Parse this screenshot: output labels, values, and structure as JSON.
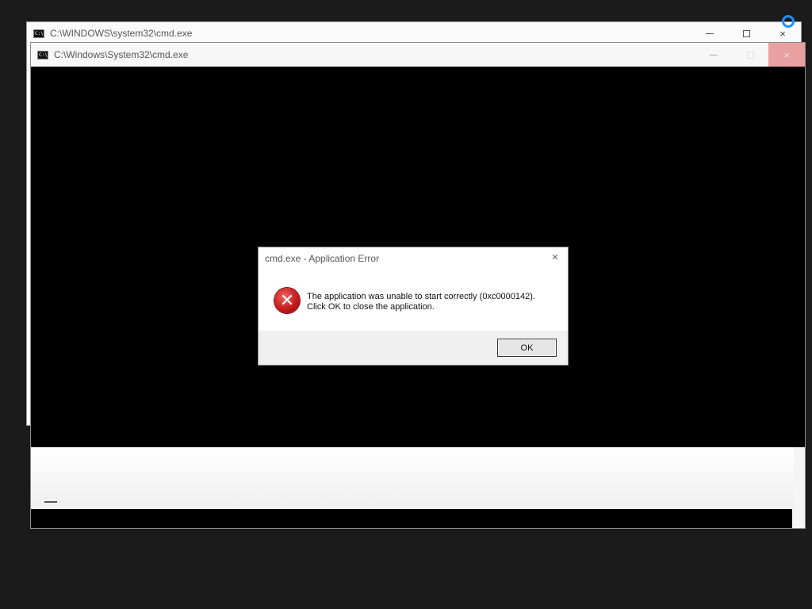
{
  "back_window": {
    "title": "C:\\WINDOWS\\system32\\cmd.exe",
    "icon": "cmd-icon",
    "minimize": "minimize-icon",
    "maximize": "maximize-icon",
    "close": "×"
  },
  "front_window": {
    "title": "C:\\Windows\\System32\\cmd.exe",
    "icon": "cmd-icon",
    "close": "×"
  },
  "dialog": {
    "title": "cmd.exe - Application Error",
    "close": "×",
    "icon": "error-icon",
    "error_glyph": "✕",
    "message_line1": "The application was unable to start correctly (0xc0000142).",
    "message_line2": "Click OK to close the application.",
    "ok_label": "OK"
  },
  "cmd_icon_text": "C:\\.",
  "colors": {
    "desktop": "#1b1b1b",
    "console": "#000000",
    "error_red": "#c01818",
    "cursor_blue": "#1e90ff"
  }
}
